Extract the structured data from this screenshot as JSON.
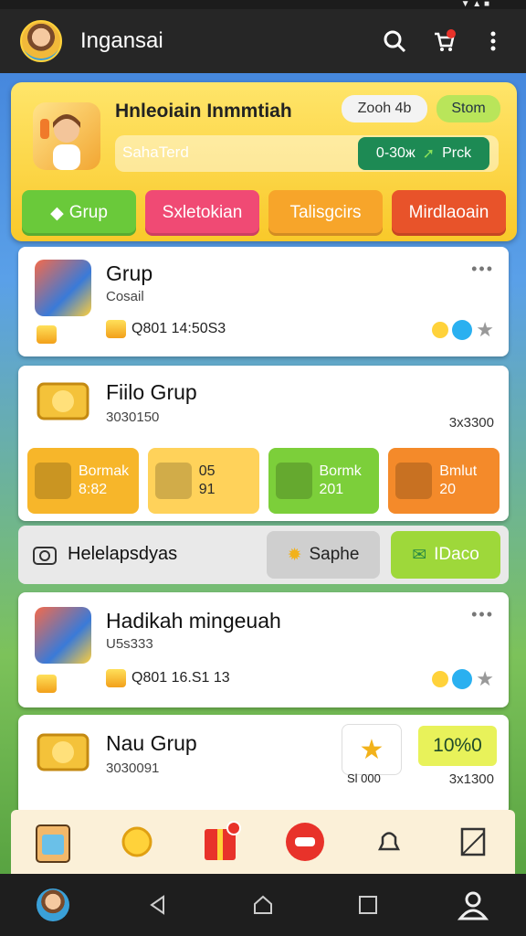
{
  "app": {
    "title": "Ingansai"
  },
  "panel": {
    "title": "Hnleoiain Inmmtiah",
    "zoom_label": "Zooh 4b",
    "status_label": "Stom",
    "subbar_text": "SahaTerd",
    "pick_code": "0-30ж",
    "pick_label": "Prck",
    "tabs": [
      "Grup",
      "Sxletokian",
      "Talisgcirs",
      "Mirdlaoain"
    ]
  },
  "cards": [
    {
      "name": "Grup",
      "meta": "Cosail",
      "value": "Q801 14:50S3"
    },
    {
      "name": "Fiilo Grup",
      "meta": "3030150",
      "right_value": "3x3300",
      "tiles": [
        {
          "line1": "Bormak",
          "line2": "8:82"
        },
        {
          "line1": "05",
          "line2": "91"
        },
        {
          "line1": "Bormk",
          "line2": "201"
        },
        {
          "line1": "Bmlut",
          "line2": "20"
        }
      ]
    }
  ],
  "strip": {
    "label": "Helelapsdyas",
    "save_label": "Saphe",
    "ok_label": "IDaco"
  },
  "cards2": [
    {
      "name": "Hadikah mingeuah",
      "meta": "U5s333",
      "value": "Q801 16.S1 13"
    },
    {
      "name": "Nau Grup",
      "meta": "3030091",
      "rating_value": "Sl 000",
      "score": "10%0",
      "right_value": "3x1300"
    }
  ],
  "colors": {
    "accent": "#f9c92a",
    "appbar": "#262626",
    "green": "#7ccf3a",
    "pink": "#f04a74",
    "orange": "#f7a52a",
    "red": "#e8532a"
  }
}
